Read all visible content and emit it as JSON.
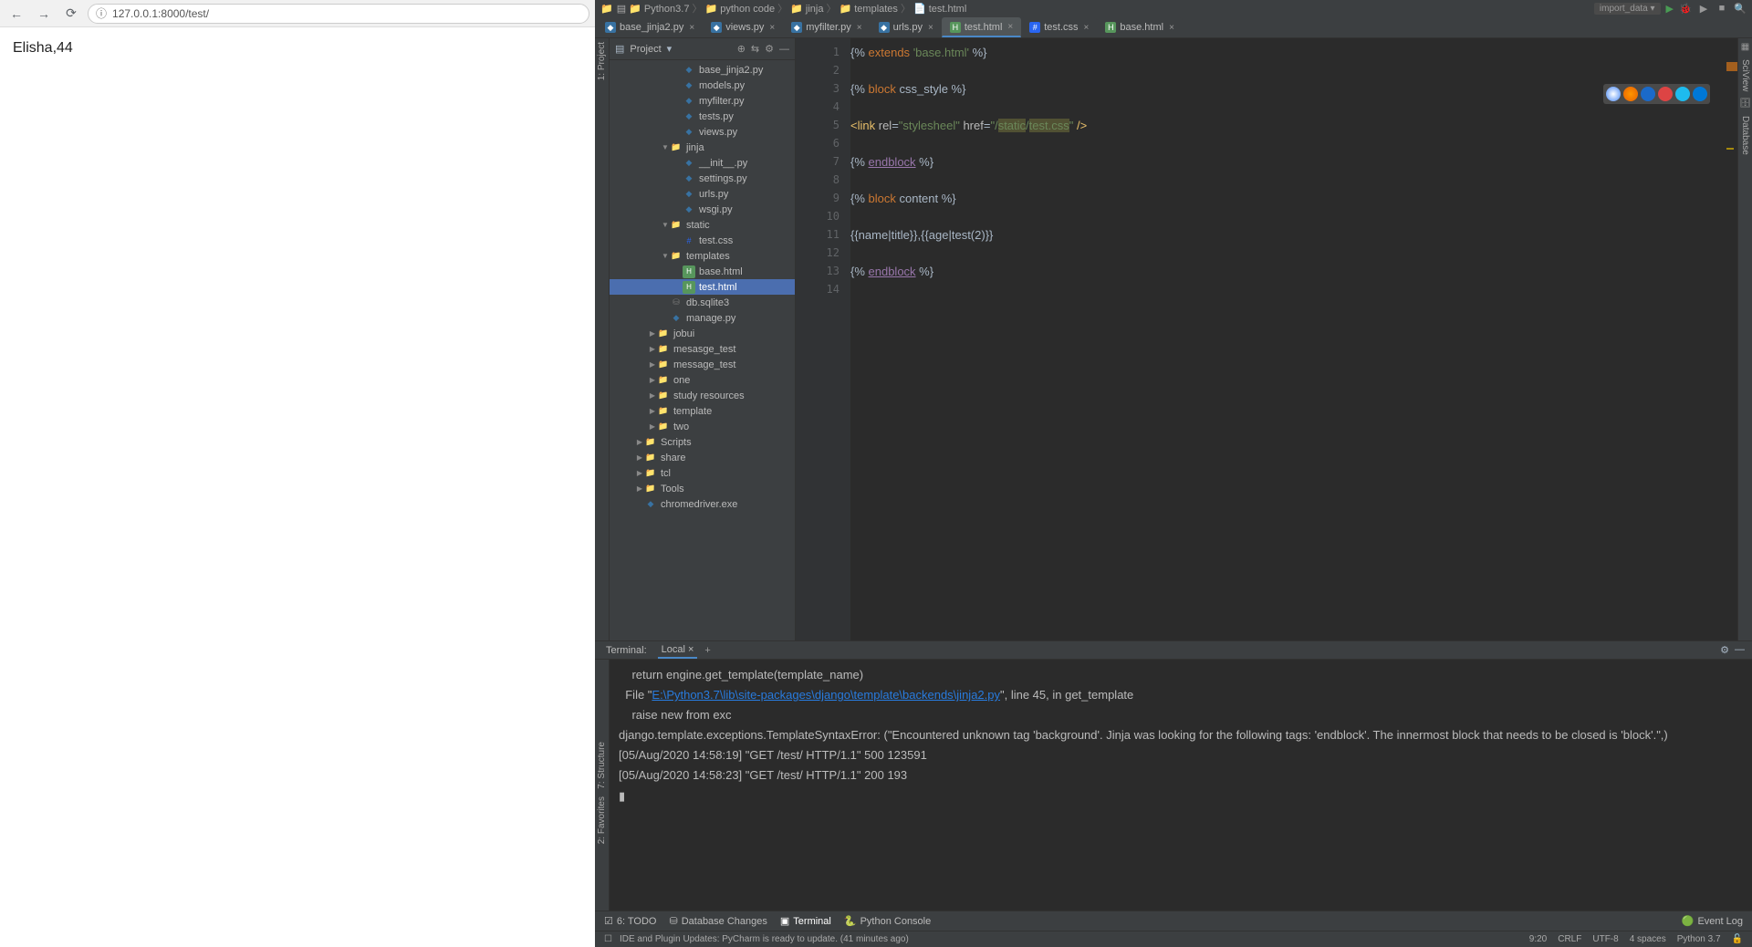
{
  "browser": {
    "url": "127.0.0.1:8000/test/",
    "page_text": "Elisha,44"
  },
  "ide": {
    "breadcrumbs": [
      "Python3.7",
      "python code",
      "jinja",
      "templates",
      "test.html"
    ],
    "run_config": "import_data",
    "project_panel": {
      "title": "Project",
      "tree": [
        {
          "depth": 5,
          "arrow": "",
          "ico": "py",
          "label": "base_jinja2.py"
        },
        {
          "depth": 5,
          "arrow": "",
          "ico": "py",
          "label": "models.py"
        },
        {
          "depth": 5,
          "arrow": "",
          "ico": "py",
          "label": "myfilter.py"
        },
        {
          "depth": 5,
          "arrow": "",
          "ico": "py",
          "label": "tests.py"
        },
        {
          "depth": 5,
          "arrow": "",
          "ico": "py",
          "label": "views.py"
        },
        {
          "depth": 4,
          "arrow": "▼",
          "ico": "folder",
          "label": "jinja"
        },
        {
          "depth": 5,
          "arrow": "",
          "ico": "py",
          "label": "__init__.py"
        },
        {
          "depth": 5,
          "arrow": "",
          "ico": "py",
          "label": "settings.py"
        },
        {
          "depth": 5,
          "arrow": "",
          "ico": "py",
          "label": "urls.py"
        },
        {
          "depth": 5,
          "arrow": "",
          "ico": "py",
          "label": "wsgi.py"
        },
        {
          "depth": 4,
          "arrow": "▼",
          "ico": "folder",
          "label": "static"
        },
        {
          "depth": 5,
          "arrow": "",
          "ico": "css",
          "label": "test.css"
        },
        {
          "depth": 4,
          "arrow": "▼",
          "ico": "folder",
          "label": "templates"
        },
        {
          "depth": 5,
          "arrow": "",
          "ico": "html",
          "label": "base.html"
        },
        {
          "depth": 5,
          "arrow": "",
          "ico": "html",
          "label": "test.html",
          "selected": true
        },
        {
          "depth": 4,
          "arrow": "",
          "ico": "db",
          "label": "db.sqlite3"
        },
        {
          "depth": 4,
          "arrow": "",
          "ico": "py",
          "label": "manage.py"
        },
        {
          "depth": 3,
          "arrow": "▶",
          "ico": "folder",
          "label": "jobui"
        },
        {
          "depth": 3,
          "arrow": "▶",
          "ico": "folder",
          "label": "mesasge_test"
        },
        {
          "depth": 3,
          "arrow": "▶",
          "ico": "folder",
          "label": "message_test"
        },
        {
          "depth": 3,
          "arrow": "▶",
          "ico": "folder",
          "label": "one"
        },
        {
          "depth": 3,
          "arrow": "▶",
          "ico": "folder",
          "label": "study resources"
        },
        {
          "depth": 3,
          "arrow": "▶",
          "ico": "folder",
          "label": "template"
        },
        {
          "depth": 3,
          "arrow": "▶",
          "ico": "folder",
          "label": "two"
        },
        {
          "depth": 2,
          "arrow": "▶",
          "ico": "folder",
          "label": "Scripts"
        },
        {
          "depth": 2,
          "arrow": "▶",
          "ico": "folder",
          "label": "share"
        },
        {
          "depth": 2,
          "arrow": "▶",
          "ico": "folder",
          "label": "tcl"
        },
        {
          "depth": 2,
          "arrow": "▶",
          "ico": "folder",
          "label": "Tools"
        },
        {
          "depth": 2,
          "arrow": "",
          "ico": "py",
          "label": "chromedriver.exe"
        }
      ]
    },
    "tabs": [
      {
        "label": "base_jinja2.py",
        "ico": "py",
        "active": false
      },
      {
        "label": "views.py",
        "ico": "py",
        "active": false
      },
      {
        "label": "myfilter.py",
        "ico": "py",
        "active": false
      },
      {
        "label": "urls.py",
        "ico": "py",
        "active": false
      },
      {
        "label": "test.html",
        "ico": "html",
        "active": true
      },
      {
        "label": "test.css",
        "ico": "css",
        "active": false
      },
      {
        "label": "base.html",
        "ico": "html",
        "active": false
      }
    ],
    "editor": {
      "line_count": 14,
      "lines": [
        {
          "tokens": [
            {
              "t": "{% ",
              "c": ""
            },
            {
              "t": "extends",
              "c": "tok-kw"
            },
            {
              "t": " ",
              "c": ""
            },
            {
              "t": "'base.html'",
              "c": "tok-str"
            },
            {
              "t": " %}",
              "c": ""
            }
          ]
        },
        {
          "tokens": []
        },
        {
          "tokens": [
            {
              "t": "{% ",
              "c": ""
            },
            {
              "t": "block",
              "c": "tok-kw"
            },
            {
              "t": " css_style %}",
              "c": ""
            }
          ]
        },
        {
          "tokens": []
        },
        {
          "tokens": [
            {
              "t": "<link",
              "c": "tok-tag"
            },
            {
              "t": " ",
              "c": ""
            },
            {
              "t": "rel",
              "c": "tok-attr"
            },
            {
              "t": "=",
              "c": ""
            },
            {
              "t": "\"stylesheel\"",
              "c": "tok-str"
            },
            {
              "t": " ",
              "c": ""
            },
            {
              "t": "href",
              "c": "tok-attr"
            },
            {
              "t": "=",
              "c": ""
            },
            {
              "t": "\"/",
              "c": "tok-str"
            },
            {
              "t": "static",
              "c": "tok-str tok-bg"
            },
            {
              "t": "/",
              "c": "tok-str"
            },
            {
              "t": "test.css",
              "c": "tok-str tok-bg"
            },
            {
              "t": "\"",
              "c": "tok-str"
            },
            {
              "t": " />",
              "c": "tok-tag"
            }
          ]
        },
        {
          "tokens": []
        },
        {
          "tokens": [
            {
              "t": "{% ",
              "c": ""
            },
            {
              "t": "endblock",
              "c": "tok-id"
            },
            {
              "t": " %}",
              "c": ""
            }
          ]
        },
        {
          "tokens": []
        },
        {
          "tokens": [
            {
              "t": "{% ",
              "c": ""
            },
            {
              "t": "block",
              "c": "tok-kw"
            },
            {
              "t": " content %}",
              "c": ""
            }
          ]
        },
        {
          "tokens": []
        },
        {
          "tokens": [
            {
              "t": "{{name|title}},{{age|test(2)}}",
              "c": ""
            }
          ]
        },
        {
          "tokens": []
        },
        {
          "tokens": [
            {
              "t": "{% ",
              "c": ""
            },
            {
              "t": "endblock",
              "c": "tok-id"
            },
            {
              "t": " %}",
              "c": ""
            }
          ]
        },
        {
          "tokens": []
        }
      ]
    },
    "terminal": {
      "label": "Terminal:",
      "tab": "Local",
      "lines": [
        {
          "pre": "    return engine.get_template(template_name)"
        },
        {
          "pre": "  File \"",
          "link": "E:\\Python3.7\\lib\\site-packages\\django\\template\\backends\\jinja2.py",
          "post": "\", line 45, in get_template"
        },
        {
          "pre": "    raise new from exc"
        },
        {
          "pre": "django.template.exceptions.TemplateSyntaxError: (\"Encountered unknown tag 'background'. Jinja was looking for the following tags: 'endblock'. The innermost block that needs to be closed is 'block'.\",)"
        },
        {
          "pre": "[05/Aug/2020 14:58:19] \"GET /test/ HTTP/1.1\" 500 123591"
        },
        {
          "pre": "[05/Aug/2020 14:58:23] \"GET /test/ HTTP/1.1\" 200 193"
        },
        {
          "pre": "▮"
        }
      ]
    },
    "bottom_tabs": {
      "todo": "6: TODO",
      "db": "Database Changes",
      "terminal": "Terminal",
      "console": "Python Console",
      "event_log": "Event Log"
    },
    "status": {
      "update_msg": "IDE and Plugin Updates: PyCharm is ready to update. (41 minutes ago)",
      "pos": "9:20",
      "eol": "CRLF",
      "enc": "UTF-8",
      "indent": "4 spaces",
      "py": "Python 3.7"
    },
    "side_labels": {
      "project": "1: Project",
      "structure": "7: Structure",
      "favorites": "2: Favorites",
      "sciview": "SciView",
      "database": "Database"
    }
  }
}
